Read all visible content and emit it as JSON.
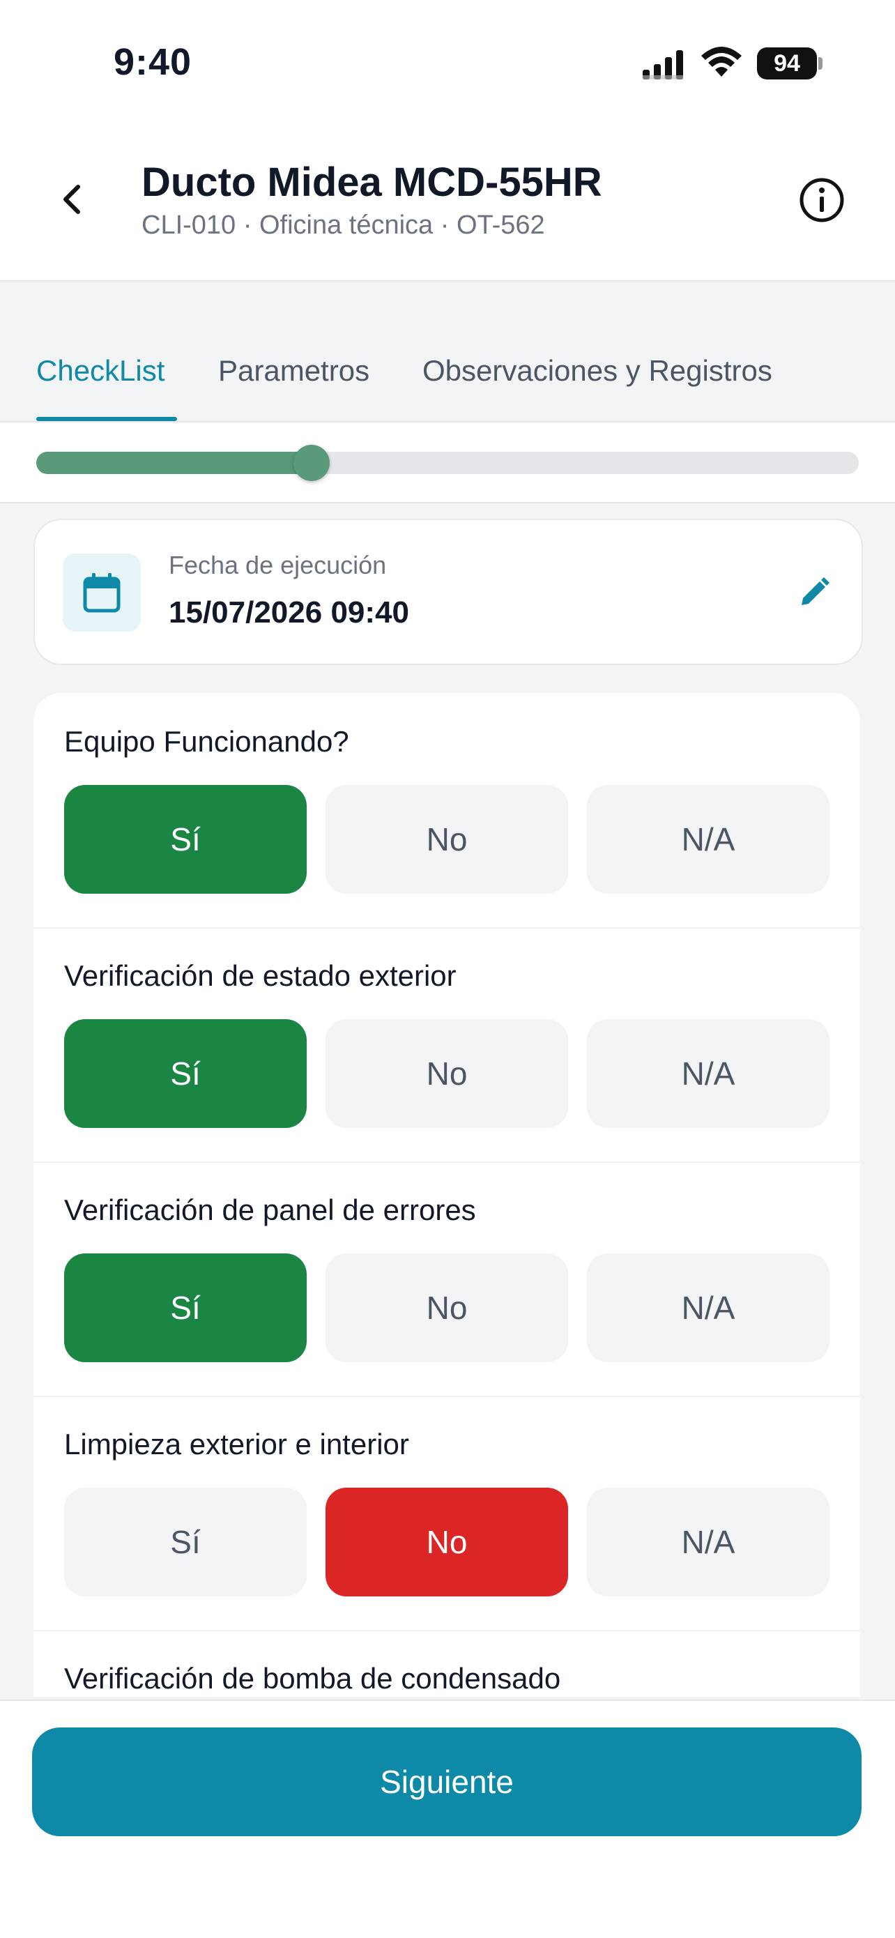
{
  "status_bar": {
    "time": "9:40",
    "battery": "94"
  },
  "header": {
    "title": "Ducto Midea MCD-55HR",
    "subtitle": "CLI-010 · Oficina técnica · OT-562"
  },
  "tabs": [
    {
      "label": "CheckList",
      "active": true
    },
    {
      "label": "Parametros",
      "active": false
    },
    {
      "label": "Observaciones y Registros",
      "active": false
    }
  ],
  "progress": {
    "fraction": 0.335
  },
  "execution_date": {
    "label": "Fecha de ejecución",
    "value": "15/07/2026 09:40"
  },
  "options": {
    "yes": "Sí",
    "no": "No",
    "na": "N/A"
  },
  "checklist": [
    {
      "question": "Equipo Funcionando?",
      "answer": "yes"
    },
    {
      "question": "Verificación de estado exterior",
      "answer": "yes"
    },
    {
      "question": "Verificación de panel de errores",
      "answer": "yes"
    },
    {
      "question": "Limpieza exterior e interior",
      "answer": "no"
    },
    {
      "question": "Verificación de bomba de condensado",
      "answer": null
    }
  ],
  "footer": {
    "next_label": "Siguiente"
  },
  "colors": {
    "accent": "#0e8aa8",
    "yes": "#1b8543",
    "no": "#dc2626",
    "progress": "#5a9a79"
  }
}
